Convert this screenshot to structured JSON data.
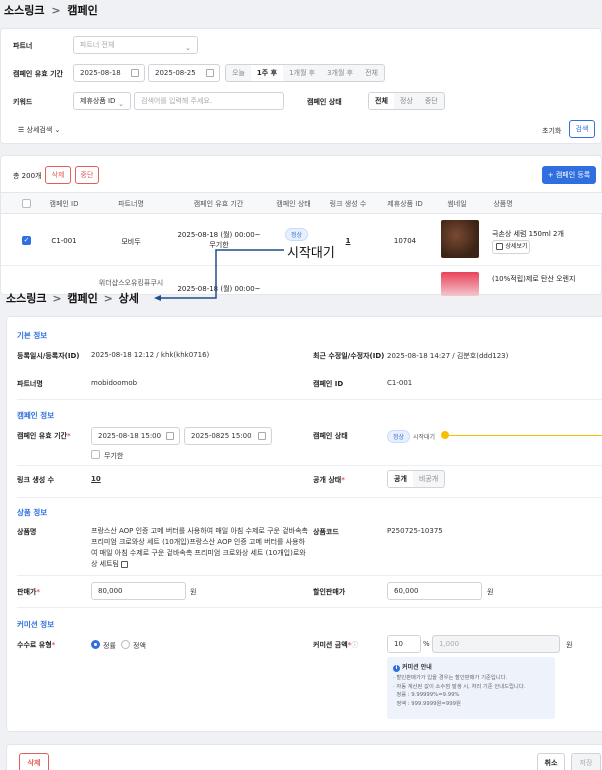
{
  "list_page": {
    "breadcrumb": {
      "root": "소스링크",
      "sep": ">",
      "current": "캠페인"
    },
    "filters": {
      "partner_label": "파트너",
      "partner_placeholder": "파트너 전체",
      "period_label": "캠페인 유효 기간",
      "period_from": "2025-08-18",
      "period_to": "2025-08-25",
      "quick_ranges": [
        "오늘",
        "1주 후",
        "1개월 후",
        "3개월 후",
        "전체"
      ],
      "quick_selected": 1,
      "keyword_label": "키워드",
      "keyword_type": "제휴상품 ID",
      "keyword_placeholder": "검색어를 입력해 주세요.",
      "status_label": "캠페인 상태",
      "status_options": [
        "전체",
        "정상",
        "중단"
      ],
      "status_selected": 0,
      "advanced_label": "상세검색",
      "reset_label": "초기화",
      "search_label": "검색"
    },
    "table": {
      "total": "총 200개",
      "delete_label": "삭제",
      "stop_label": "중단",
      "register_label": "+ 캠페인 등록",
      "headers": [
        "캠페인 ID",
        "파트너명",
        "캠페인 유효 기간",
        "캠페인 상태",
        "링크 생성 수",
        "제휴상품 ID",
        "썸네일",
        "상품명"
      ],
      "rows": [
        {
          "id": "C1-001",
          "partner": "모비두",
          "period": "2025-08-18 (월) 00:00~",
          "period2": "무기한",
          "status": "정상",
          "links": "1",
          "product_id": "10704",
          "name": "극손상 세럼 150ml 2개",
          "detail": "상세보기"
        },
        {
          "id": "",
          "partner": "위더샵스오유킹퓨쿠시",
          "period": "2025-08-18 (월) 00:00~",
          "period2": "",
          "status": "",
          "links": "",
          "product_id": "",
          "name": "(10%적립)제로 탄산 오렌지",
          "detail": ""
        }
      ]
    },
    "callout": "시작대기"
  },
  "detail_page": {
    "breadcrumb": {
      "root": "소스링크",
      "sep": ">",
      "mid": "캠페인",
      "current": "상세"
    },
    "basic": {
      "title": "기본 정보",
      "reg_label": "등록일시/등록자(ID)",
      "reg_value": "2025-08-18 12:12 / khk(khk0716)",
      "mod_label": "최근 수정일/수정자(ID)",
      "mod_value": "2025-08-18 14:27 / 김분호(ddd123)",
      "partner_label": "파트너명",
      "partner_value": "mobidoomob",
      "campaign_id_label": "캠페인 ID",
      "campaign_id_value": "C1-001"
    },
    "campaign": {
      "title": "캠페인 정보",
      "period_label": "캠페인 유효 기간",
      "period_from": "2025-08-18 15:00",
      "period_to": "2025-0825 15:00",
      "unlimited_label": "무기한",
      "status_label": "캠페인 상태",
      "status_badge": "정상",
      "status_sub": "시작대기",
      "links_label": "링크 생성 수",
      "links_value": "10",
      "public_label": "공개 상태",
      "public_options": [
        "공개",
        "비공개"
      ],
      "public_selected": 0
    },
    "product": {
      "title": "상품 정보",
      "name_label": "상품명",
      "name_lines": [
        "프랑스산 AOP 인증 고메 버터를 사용하여 매일 아침 수제로 구운 겉바속촉",
        "프리미엄 크로와상 세트 (10개입)프랑스산 AOP 인증 고메 버터를 사용하",
        "여 매일 아침 수제로 구운 겉바속촉 프리미엄 크로와상 세트 (10개입)로와",
        "상 세트팀"
      ],
      "code_label": "상품코드",
      "code_value": "P250725-10375",
      "price_label": "판매가",
      "price_value": "80,000",
      "discount_label": "할인판매가",
      "discount_value": "60,000",
      "currency": "원"
    },
    "commission": {
      "title": "커미션 정보",
      "type_label": "수수료 유형",
      "type_options": [
        "정률",
        "정액"
      ],
      "type_selected": 0,
      "amount_label": "커미션 금액",
      "percent_value": "10",
      "percent_unit": "%",
      "amount_value": "1,000",
      "currency": "원",
      "info_title": "커미션 안내",
      "info_lines": [
        "· 할인판매가가 입을 경우는 할인판매가 기준입니다.",
        "· 자동 계산된 값이 소수점 발생 시, 처리 기준 안내드립니다.",
        "  정률 : 9.99999%=9.99%",
        "  정액 : 999.9999원=999원"
      ]
    },
    "footer": {
      "delete_label": "삭제",
      "cancel_label": "취소",
      "save_label": "저장"
    }
  }
}
